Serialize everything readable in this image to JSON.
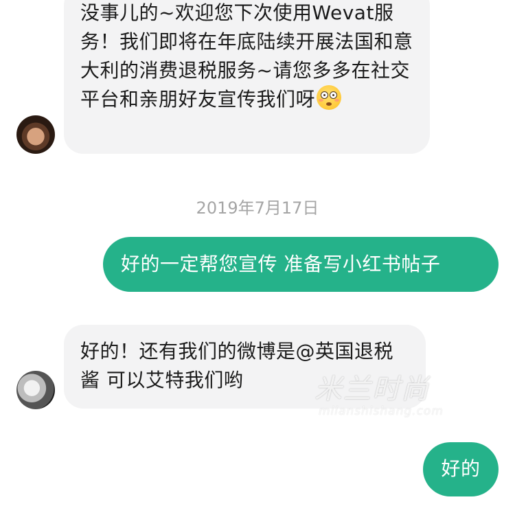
{
  "messages": {
    "msg1": {
      "text": "没事儿的~欢迎您下次使用Wevat服务！我们即将在年底陆续开展法国和意大利的消费退税服务~请您多多在社交平台和亲朋好友宣传我们呀",
      "emoji": "flushed-face-emoji",
      "sender": "incoming"
    },
    "timestamp": "2019年7月17日",
    "msg2": {
      "text": "好的一定帮您宣传 准备写小红书帖子",
      "sender": "outgoing"
    },
    "msg3": {
      "text": "好的！还有我们的微博是@英国退税酱 可以艾特我们哟",
      "sender": "incoming"
    },
    "msg4": {
      "text": "好的",
      "sender": "outgoing"
    }
  },
  "watermark": {
    "cn": "米兰时尚",
    "en": "milanshishang.com"
  },
  "colors": {
    "outgoing_bubble": "#25b28a",
    "incoming_bubble": "#f3f3f4",
    "timestamp_text": "#a5a5a5"
  }
}
